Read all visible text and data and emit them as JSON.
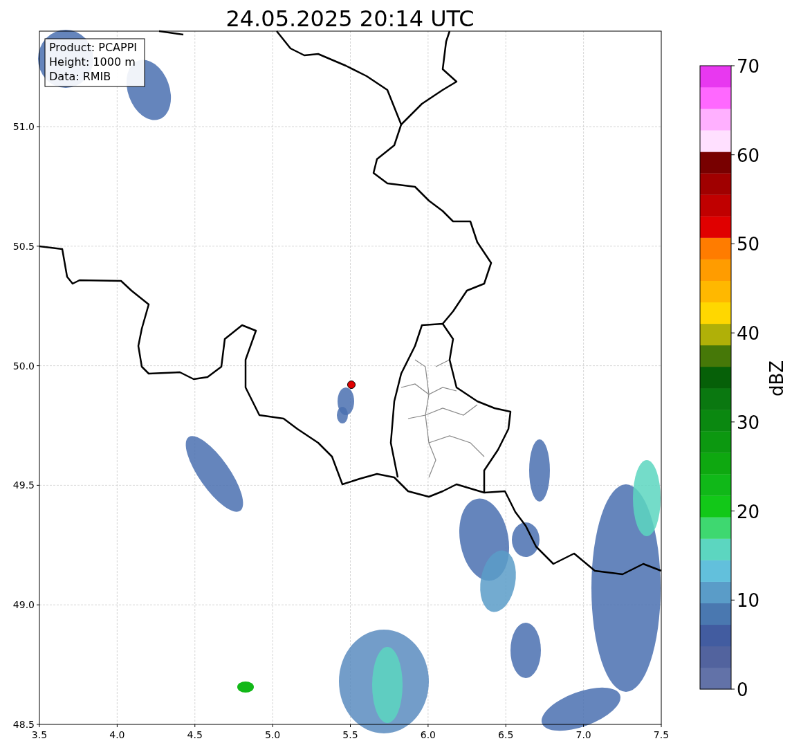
{
  "title": "24.05.2025 20:14 UTC",
  "map": {
    "info_box": [
      "Product: PCAPPI",
      "Height: 1000 m",
      "Data: RMIB"
    ],
    "xticks": [
      "3.5",
      "4.0",
      "4.5",
      "5.0",
      "5.5",
      "6.0",
      "6.5",
      "7.0",
      "7.5"
    ],
    "yticks": [
      "51.0",
      "50.5",
      "50.0",
      "49.5",
      "49.0",
      "48.5"
    ]
  },
  "colorbar": {
    "label": "dBZ",
    "ticks": [
      "70",
      "60",
      "50",
      "40",
      "30",
      "20",
      "10",
      "0"
    ],
    "segments": [
      {
        "color": "#6272a8"
      },
      {
        "color": "#52639e"
      },
      {
        "color": "#425ca0"
      },
      {
        "color": "#4a78b0"
      },
      {
        "color": "#5a9cc8"
      },
      {
        "color": "#62c0dc"
      },
      {
        "color": "#5cd6c0"
      },
      {
        "color": "#3ed870"
      },
      {
        "color": "#12c818"
      },
      {
        "color": "#10b818"
      },
      {
        "color": "#0ea810"
      },
      {
        "color": "#0c9810"
      },
      {
        "color": "#0a8810"
      },
      {
        "color": "#0a7810"
      },
      {
        "color": "#066008"
      },
      {
        "color": "#467808"
      },
      {
        "color": "#b0b008"
      },
      {
        "color": "#ffd700"
      },
      {
        "color": "#ffb800"
      },
      {
        "color": "#ff9c00"
      },
      {
        "color": "#ff7c00"
      },
      {
        "color": "#e00000"
      },
      {
        "color": "#c00000"
      },
      {
        "color": "#a00000"
      },
      {
        "color": "#780000"
      },
      {
        "color": "#ffe0ff"
      },
      {
        "color": "#ffb0ff"
      },
      {
        "color": "#ff68ff"
      },
      {
        "color": "#e838f0"
      }
    ]
  }
}
